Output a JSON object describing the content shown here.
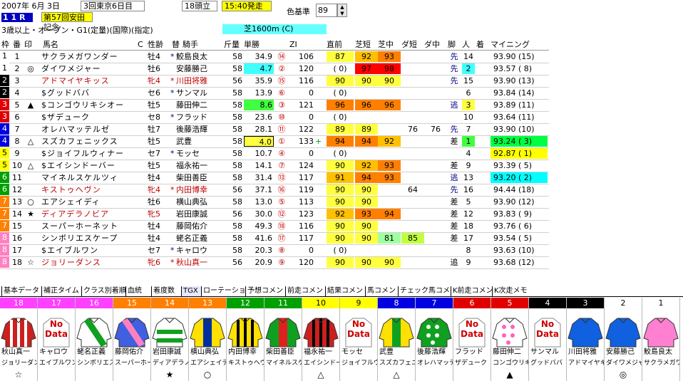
{
  "header": {
    "date": "2007年  6月  3日",
    "meeting": "3回東京6日目",
    "runners": "18頭立",
    "post_time": "15:40発走",
    "color_base_label": "色基準",
    "color_base_value": "89",
    "race_no": "1 1 R",
    "race_name": "第57回安田記念",
    "conditions": "3歳以上・オープン・G1(定量)(国際)(指定)",
    "course": "芝1600m (C)"
  },
  "columns": [
    "枠",
    "番",
    "印",
    "馬名",
    "C",
    "性齢",
    "替",
    "騎手",
    "斤量",
    "単勝",
    "ZI",
    "直前",
    "芝短",
    "芝中",
    "ダ短",
    "ダ中",
    "脚",
    "人",
    "着",
    "マイニング"
  ],
  "horses": [
    {
      "waku": "1",
      "num": "1",
      "mark": "",
      "name": "サクラメガワンダー",
      "sex": "牡4",
      "swap": "*",
      "jockey": "鮫島良太",
      "wt": "58",
      "odds": "34.9",
      "pop_circle": "⑭",
      "zi": "106",
      "chokuzen": "87",
      "shiba_short": "92",
      "shiba_mid": "93",
      "da_short": "",
      "da_mid": "",
      "kyaku": "先",
      "ninki": "14",
      "chaku": "",
      "mining": "93.90 (15)"
    },
    {
      "waku": "1",
      "num": "2",
      "mark": "◎",
      "name": "ダイワメジャー",
      "sex": "牡6",
      "swap": "",
      "jockey": "安藤勝己",
      "wt": "58",
      "odds": "4.7",
      "pop_circle": "②",
      "zi": "120",
      "chokuzen": "(  0)",
      "shiba_short": "97",
      "shiba_mid": "98",
      "da_short": "",
      "da_mid": "",
      "kyaku": "先",
      "ninki": "2",
      "chaku": "",
      "mining": "93.57 ( 8)"
    },
    {
      "waku": "2",
      "num": "3",
      "mark": "",
      "name": "アドマイヤキッス",
      "sex": "牝4",
      "swap": "*",
      "jockey": "川田将雅",
      "wt": "56",
      "odds": "35.9",
      "pop_circle": "⑮",
      "zi": "116",
      "chokuzen": "90",
      "shiba_short": "90",
      "shiba_mid": "90",
      "da_short": "",
      "da_mid": "",
      "kyaku": "先",
      "ninki": "15",
      "chaku": "",
      "mining": "93.90 (13)"
    },
    {
      "waku": "2",
      "num": "4",
      "mark": "",
      "name": "$グッドババ",
      "sex": "セ6",
      "swap": "*",
      "jockey": "サンマル",
      "wt": "58",
      "odds": "13.9",
      "pop_circle": "⑥",
      "zi": "0",
      "chokuzen": "(  0)",
      "shiba_short": "",
      "shiba_mid": "",
      "da_short": "",
      "da_mid": "",
      "kyaku": "",
      "ninki": "6",
      "chaku": "",
      "mining": "93.84 (14)"
    },
    {
      "waku": "3",
      "num": "5",
      "mark": "▲",
      "name": "$コンゴウリキシオー",
      "sex": "牡5",
      "swap": "",
      "jockey": "藤田伸二",
      "wt": "58",
      "odds": "8.6",
      "pop_circle": "③",
      "zi": "121",
      "chokuzen": "96",
      "shiba_short": "96",
      "shiba_mid": "96",
      "da_short": "",
      "da_mid": "",
      "kyaku": "逃",
      "ninki": "3",
      "chaku": "",
      "mining": "93.89 (11)"
    },
    {
      "waku": "3",
      "num": "6",
      "mark": "",
      "name": "$ザデューク",
      "sex": "セ8",
      "swap": "*",
      "jockey": "フラッド",
      "wt": "58",
      "odds": "23.6",
      "pop_circle": "⑩",
      "zi": "0",
      "chokuzen": "(  0)",
      "shiba_short": "",
      "shiba_mid": "",
      "da_short": "",
      "da_mid": "",
      "kyaku": "",
      "ninki": "10",
      "chaku": "",
      "mining": "93.64 (11)"
    },
    {
      "waku": "4",
      "num": "7",
      "mark": "",
      "name": "オレハマッテルゼ",
      "sex": "牡7",
      "swap": "",
      "jockey": "後藤浩輝",
      "wt": "58",
      "odds": "28.1",
      "pop_circle": "⑪",
      "zi": "122",
      "chokuzen": "89",
      "shiba_short": "89",
      "shiba_mid": "",
      "da_short": "76",
      "da_mid": "76",
      "kyaku": "先",
      "ninki": "7",
      "chaku": "",
      "mining": "93.90 (10)"
    },
    {
      "waku": "4",
      "num": "8",
      "mark": "△",
      "name": "スズカフェニックス",
      "sex": "牡5",
      "swap": "",
      "jockey": "武豊",
      "wt": "58",
      "odds": "4.0",
      "pop_circle": "①",
      "zi": "133",
      "chokuzen": "94",
      "shiba_short": "94",
      "shiba_mid": "92",
      "da_short": "",
      "da_mid": "",
      "kyaku": "差",
      "ninki": "1",
      "chaku": "",
      "mining": "93.24 ( 3)"
    },
    {
      "waku": "5",
      "num": "9",
      "mark": "",
      "name": "$ジョイフルウィナー",
      "sex": "セ7",
      "swap": "*",
      "jockey": "モッセ",
      "wt": "58",
      "odds": "10.7",
      "pop_circle": "④",
      "zi": "0",
      "chokuzen": "(  0)",
      "shiba_short": "",
      "shiba_mid": "",
      "da_short": "",
      "da_mid": "",
      "kyaku": "",
      "ninki": "4",
      "chaku": "",
      "mining": "92.87 ( 1)"
    },
    {
      "waku": "5",
      "num": "10",
      "mark": "△",
      "name": "$エイシンドーバー",
      "sex": "牡5",
      "swap": "",
      "jockey": "福永祐一",
      "wt": "58",
      "odds": "14.1",
      "pop_circle": "⑦",
      "zi": "124",
      "chokuzen": "90",
      "shiba_short": "92",
      "shiba_mid": "93",
      "da_short": "",
      "da_mid": "",
      "kyaku": "差",
      "ninki": "9",
      "chaku": "",
      "mining": "93.39 ( 5)"
    },
    {
      "waku": "6",
      "num": "11",
      "mark": "",
      "name": "マイネルスケルツィ",
      "sex": "牡4",
      "swap": "",
      "jockey": "柴田善臣",
      "wt": "58",
      "odds": "31.4",
      "pop_circle": "⑬",
      "zi": "117",
      "chokuzen": "91",
      "shiba_short": "94",
      "shiba_mid": "93",
      "da_short": "",
      "da_mid": "",
      "kyaku": "逃",
      "ninki": "13",
      "chaku": "",
      "mining": "93.20 ( 2)"
    },
    {
      "waku": "6",
      "num": "12",
      "mark": "",
      "name": "キストゥヘヴン",
      "sex": "牝4",
      "swap": "*",
      "jockey": "内田博幸",
      "wt": "56",
      "odds": "37.1",
      "pop_circle": "⑯",
      "zi": "119",
      "chokuzen": "90",
      "shiba_short": "90",
      "shiba_mid": "",
      "da_short": "64",
      "da_mid": "",
      "kyaku": "先",
      "ninki": "16",
      "chaku": "",
      "mining": "94.44 (18)"
    },
    {
      "waku": "7",
      "num": "13",
      "mark": "○",
      "name": "エアシェイディ",
      "sex": "牡6",
      "swap": "",
      "jockey": "横山典弘",
      "wt": "58",
      "odds": "13.0",
      "pop_circle": "⑤",
      "zi": "113",
      "chokuzen": "90",
      "shiba_short": "90",
      "shiba_mid": "",
      "da_short": "",
      "da_mid": "",
      "kyaku": "差",
      "ninki": "5",
      "chaku": "",
      "mining": "93.90 (12)"
    },
    {
      "waku": "7",
      "num": "14",
      "mark": "★",
      "name": "ディアデラノビア",
      "sex": "牝5",
      "swap": "",
      "jockey": "岩田康誠",
      "wt": "56",
      "odds": "30.0",
      "pop_circle": "⑫",
      "zi": "123",
      "chokuzen": "92",
      "shiba_short": "93",
      "shiba_mid": "94",
      "da_short": "",
      "da_mid": "",
      "kyaku": "差",
      "ninki": "12",
      "chaku": "",
      "mining": "93.83 ( 9)"
    },
    {
      "waku": "7",
      "num": "15",
      "mark": "",
      "name": "スーパーホーネット",
      "sex": "牡4",
      "swap": "",
      "jockey": "藤岡佑介",
      "wt": "58",
      "odds": "49.3",
      "pop_circle": "⑱",
      "zi": "116",
      "chokuzen": "90",
      "shiba_short": "90",
      "shiba_mid": "",
      "da_short": "",
      "da_mid": "",
      "kyaku": "差",
      "ninki": "18",
      "chaku": "",
      "mining": "93.76 ( 6)"
    },
    {
      "waku": "8",
      "num": "16",
      "mark": "",
      "name": "シンボリエスケープ",
      "sex": "牡4",
      "swap": "",
      "jockey": "蛯名正義",
      "wt": "58",
      "odds": "41.6",
      "pop_circle": "⑰",
      "zi": "117",
      "chokuzen": "90",
      "shiba_short": "90",
      "shiba_mid": "81",
      "da_short": "85",
      "da_mid": "",
      "kyaku": "差",
      "ninki": "17",
      "chaku": "",
      "mining": "93.54 ( 5)"
    },
    {
      "waku": "8",
      "num": "17",
      "mark": "",
      "name": "$エイブルワン",
      "sex": "セ7",
      "swap": "*",
      "jockey": "キャロウ",
      "wt": "58",
      "odds": "20.3",
      "pop_circle": "⑧",
      "zi": "0",
      "chokuzen": "(  0)",
      "shiba_short": "",
      "shiba_mid": "",
      "da_short": "",
      "da_mid": "",
      "kyaku": "",
      "ninki": "8",
      "chaku": "",
      "mining": "93.63 (10)"
    },
    {
      "waku": "8",
      "num": "18",
      "mark": "☆",
      "name": "ジョリーダンス",
      "sex": "牝6",
      "swap": "*",
      "jockey": "秋山真一",
      "wt": "56",
      "odds": "20.9",
      "pop_circle": "⑨",
      "zi": "120",
      "chokuzen": "90",
      "shiba_short": "90",
      "shiba_mid": "90",
      "da_short": "",
      "da_mid": "",
      "kyaku": "追",
      "ninki": "9",
      "chaku": "",
      "mining": "93.68 (12)"
    }
  ],
  "tabs": [
    "基本データ",
    "補正タイム",
    "クラス別着順",
    "血統",
    "着度数",
    "TGX",
    "ローテーション",
    "予想コメント",
    "前走コメント",
    "結果コメント",
    "馬コメント",
    "チェック馬コメント",
    "K前走コメント",
    "K次走メモ"
  ],
  "silks": [
    {
      "num": "18",
      "jockey": "秋山真一",
      "horse": "ジョリーダンス",
      "mark": "☆",
      "nodata": false
    },
    {
      "num": "17",
      "jockey": "キャロウ",
      "horse": "エイブルワン",
      "mark": "",
      "nodata": true
    },
    {
      "num": "16",
      "jockey": "蛯名正義",
      "horse": "シンボリエス",
      "mark": "",
      "nodata": false
    },
    {
      "num": "15",
      "jockey": "藤岡佑介",
      "horse": "スーパーホー",
      "mark": "",
      "nodata": false
    },
    {
      "num": "14",
      "jockey": "岩田康誠",
      "horse": "ディアデラノ",
      "mark": "★",
      "nodata": false
    },
    {
      "num": "13",
      "jockey": "横山典弘",
      "horse": "エアシェイデ",
      "mark": "○",
      "nodata": false
    },
    {
      "num": "12",
      "jockey": "内田博幸",
      "horse": "キストゥヘヴ",
      "mark": "",
      "nodata": false
    },
    {
      "num": "11",
      "jockey": "柴田善臣",
      "horse": "マイネルスケ",
      "mark": "",
      "nodata": false
    },
    {
      "num": "10",
      "jockey": "福永祐一",
      "horse": "エイシンドー",
      "mark": "△",
      "nodata": false
    },
    {
      "num": "9",
      "jockey": "モッセ",
      "horse": "ジョイフルウ",
      "mark": "",
      "nodata": true
    },
    {
      "num": "8",
      "jockey": "武豊",
      "horse": "スズカフェニ",
      "mark": "△",
      "nodata": false
    },
    {
      "num": "7",
      "jockey": "後藤浩輝",
      "horse": "オレハマッテ",
      "mark": "",
      "nodata": false
    },
    {
      "num": "6",
      "jockey": "フラッド",
      "horse": "ザデューク",
      "mark": "",
      "nodata": true
    },
    {
      "num": "5",
      "jockey": "藤田伸二",
      "horse": "コンゴウリキ",
      "mark": "▲",
      "nodata": false
    },
    {
      "num": "4",
      "jockey": "サンマル",
      "horse": "グッドババ",
      "mark": "",
      "nodata": true
    },
    {
      "num": "3",
      "jockey": "川田将雅",
      "horse": "アドマイヤキ",
      "mark": "",
      "nodata": false
    },
    {
      "num": "2",
      "jockey": "安藤勝己",
      "horse": "ダイワメジャ",
      "mark": "◎",
      "nodata": false
    },
    {
      "num": "1",
      "jockey": "鮫島良太",
      "horse": "サクラメガワ",
      "mark": "",
      "nodata": false
    }
  ],
  "nodata_label": "No Data",
  "waku_colors": {
    "1": "#ffffff",
    "2": "#000000",
    "3": "#e00000",
    "4": "#0000e0",
    "5": "#ffff00",
    "6": "#00a000",
    "7": "#ff8000",
    "8": "#ff80c0"
  }
}
